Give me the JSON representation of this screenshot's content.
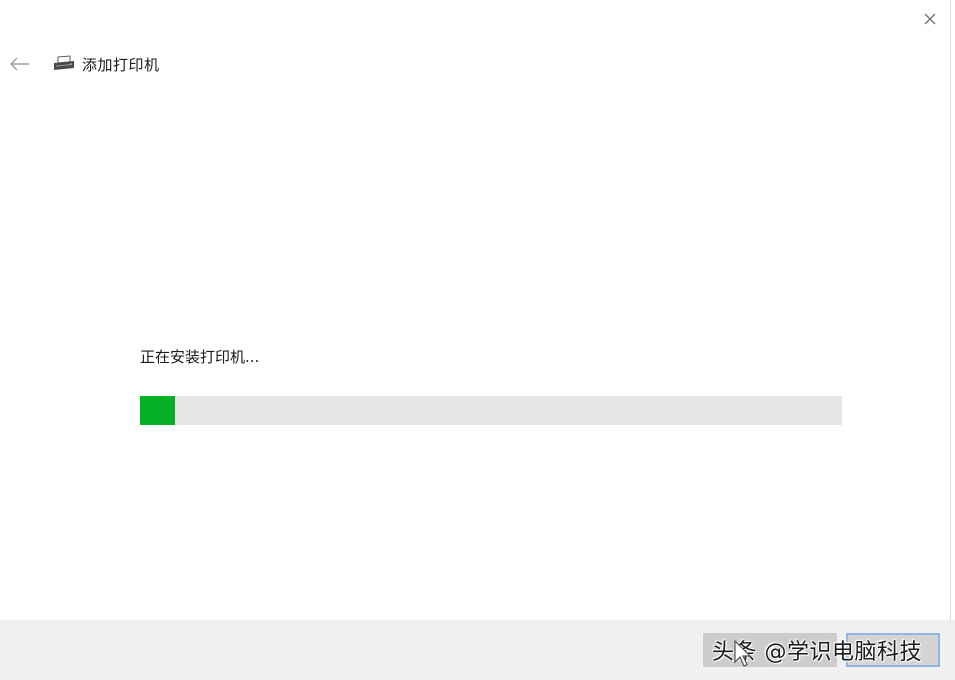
{
  "window": {
    "title": "添加打印机",
    "close_icon": "close-icon",
    "back_icon": "back-arrow-icon",
    "title_icon": "printer-icon"
  },
  "main": {
    "status_text": "正在安装打印机...",
    "progress": {
      "percent": 5,
      "fill_color": "#06b025",
      "track_color": "#e6e6e6"
    }
  },
  "footer": {
    "buttons": [
      {
        "name": "next-button",
        "label": ""
      },
      {
        "name": "cancel-button",
        "label": ""
      }
    ]
  },
  "watermark": {
    "text": "头条 @学识电脑科技"
  }
}
